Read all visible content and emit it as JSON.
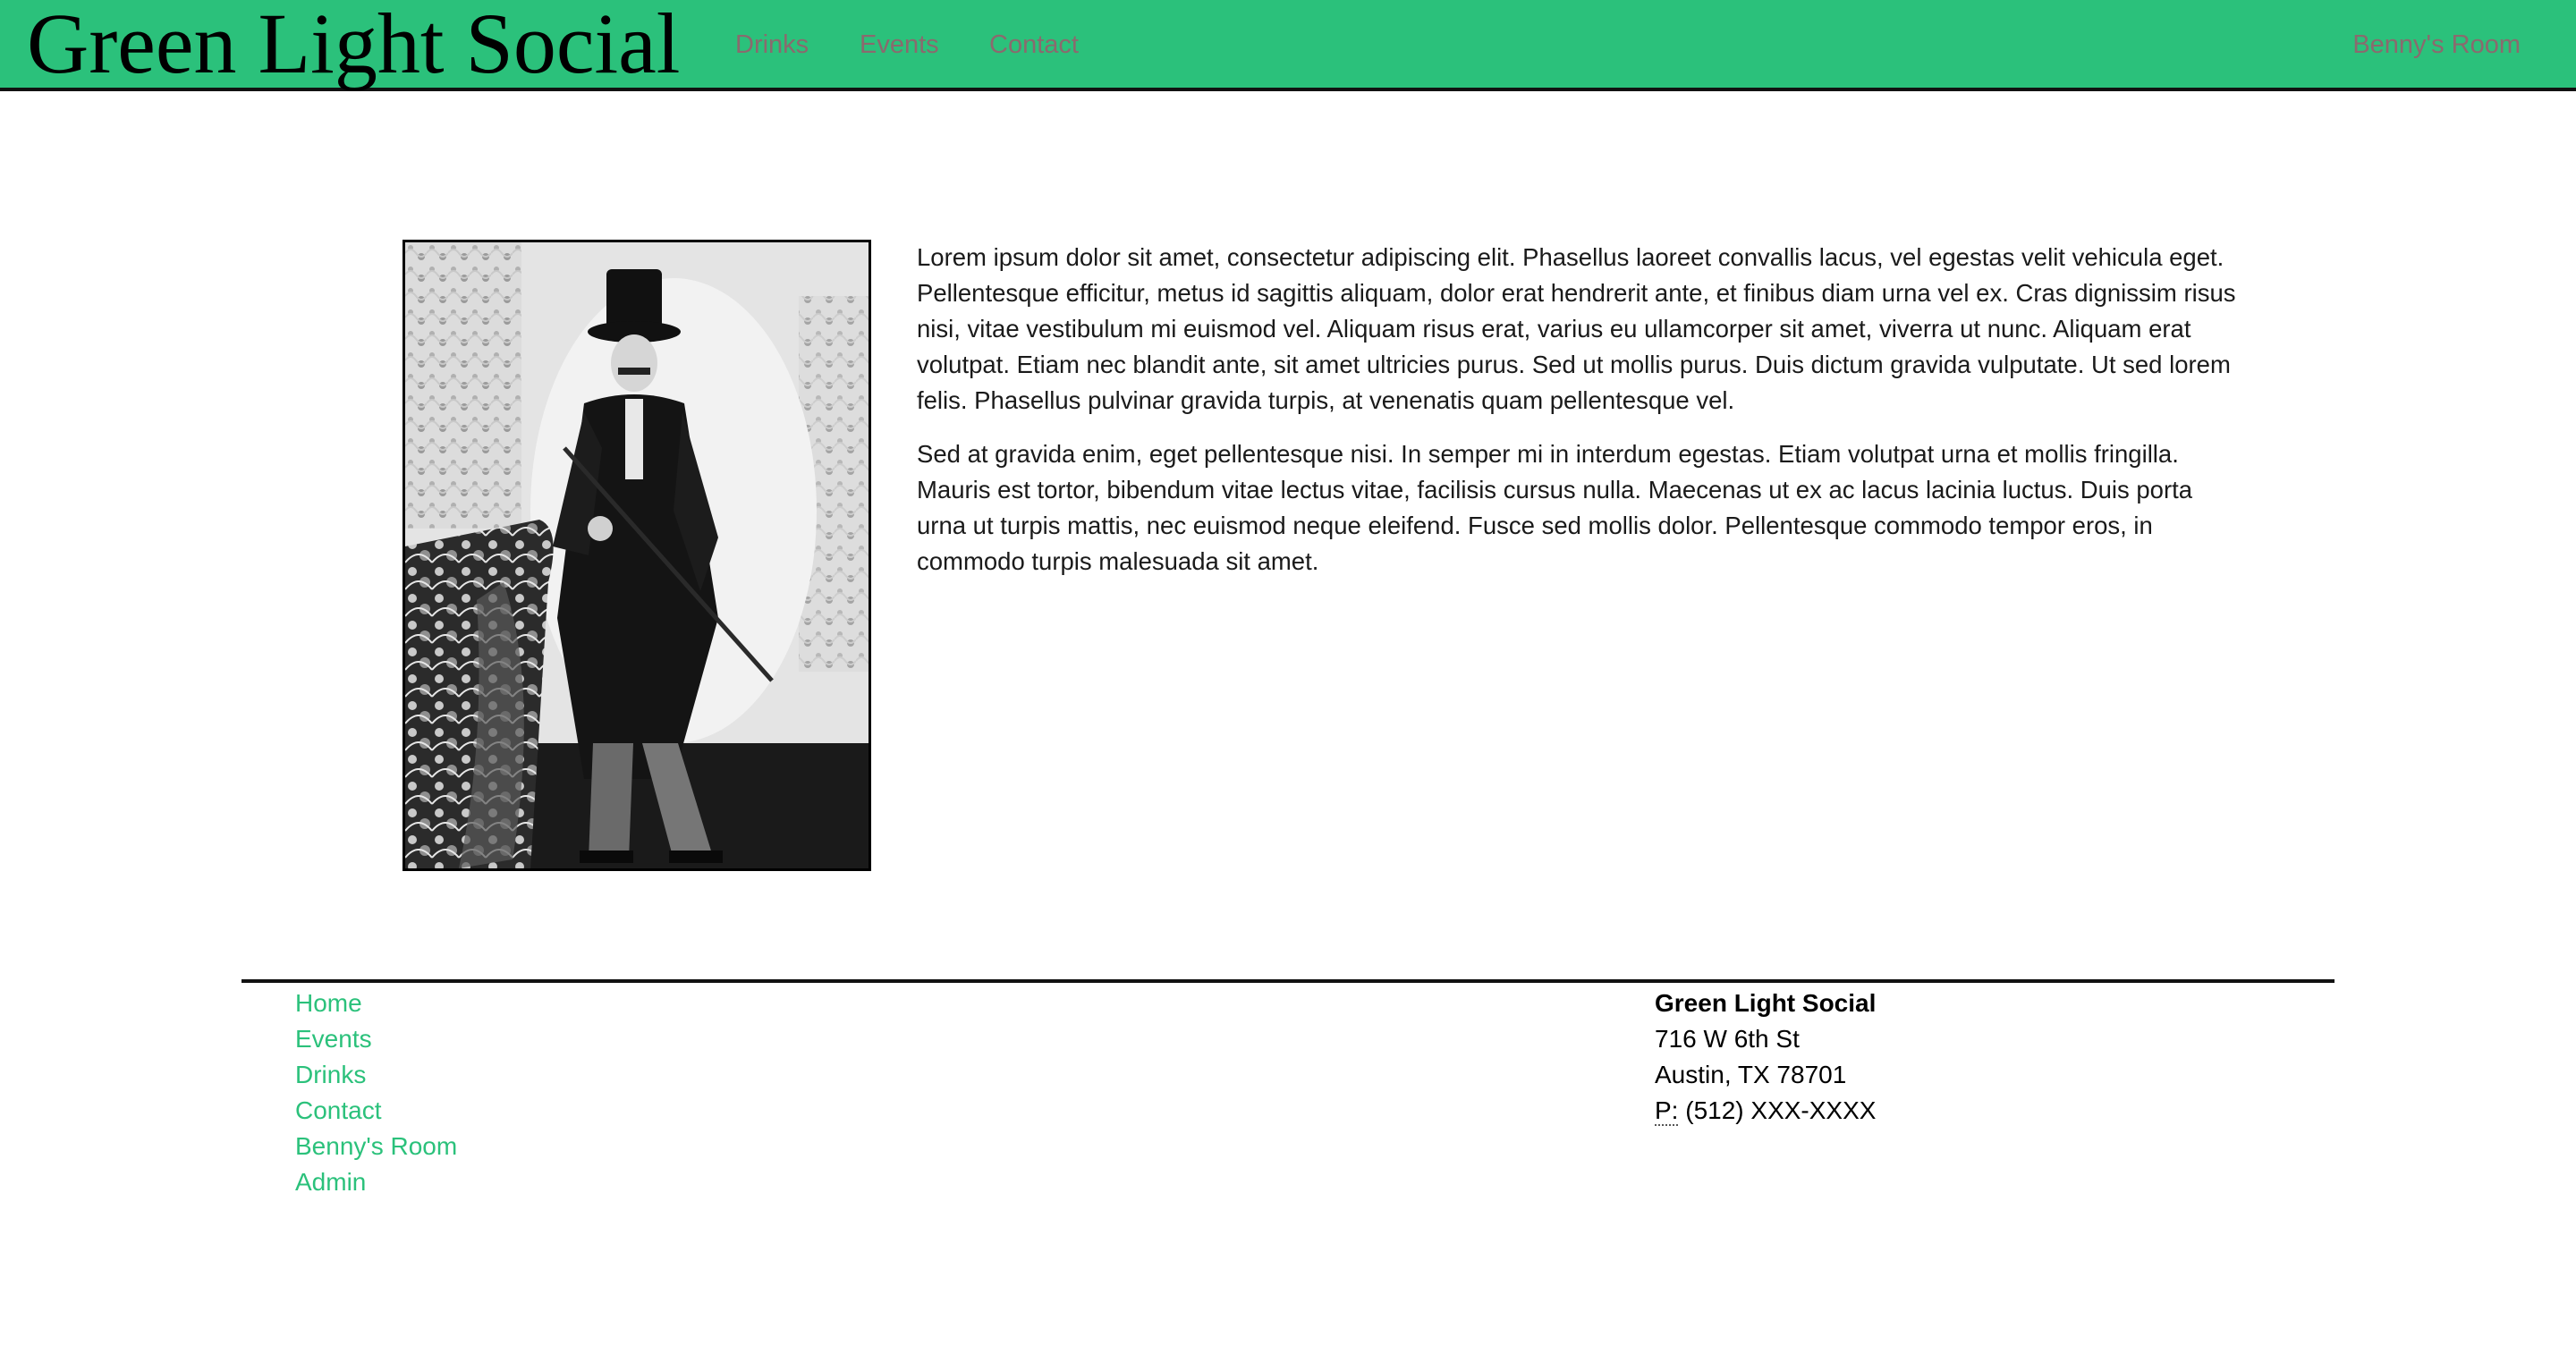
{
  "header": {
    "brand": "Green Light Social",
    "nav": {
      "drinks": "Drinks",
      "events": "Events",
      "contact": "Contact",
      "bennys_room": "Benny's Room"
    }
  },
  "main": {
    "photo_icon": "vintage-portrait-photo",
    "paragraphs": [
      "Lorem ipsum dolor sit amet, consectetur adipiscing elit. Phasellus laoreet convallis lacus, vel egestas velit vehicula eget. Pellentesque efficitur, metus id sagittis aliquam, dolor erat hendrerit ante, et finibus diam urna vel ex. Cras dignissim risus nisi, vitae vestibulum mi euismod vel. Aliquam risus erat, varius eu ullamcorper sit amet, viverra ut nunc. Aliquam erat volutpat. Etiam nec blandit ante, sit amet ultricies purus. Sed ut mollis purus. Duis dictum gravida vulputate. Ut sed lorem felis. Phasellus pulvinar gravida turpis, at venenatis quam pellentesque vel.",
      "Sed at gravida enim, eget pellentesque nisi. In semper mi in interdum egestas. Etiam volutpat urna et mollis fringilla. Mauris est tortor, bibendum vitae lectus vitae, facilisis cursus nulla. Maecenas ut ex ac lacus lacinia luctus. Duis porta urna ut turpis mattis, nec euismod neque eleifend. Fusce sed mollis dolor. Pellentesque commodo tempor eros, in commodo turpis malesuada sit amet."
    ]
  },
  "footer": {
    "links": {
      "home": "Home",
      "events": "Events",
      "drinks": "Drinks",
      "contact": "Contact",
      "bennys_room": "Benny's Room",
      "admin": "Admin"
    },
    "address": {
      "name": "Green Light Social",
      "street": "716 W 6th St",
      "city": "Austin, TX 78701",
      "phone_label": "P:",
      "phone": "(512) XXX-XXXX"
    }
  },
  "colors": {
    "brand_green": "#2bc17b",
    "nav_text": "#8a6a6e",
    "rule": "#111111"
  }
}
